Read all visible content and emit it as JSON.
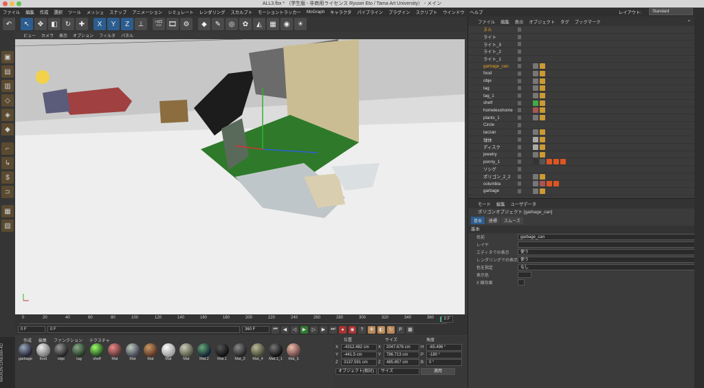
{
  "window": {
    "title": "ALL3.fbx *  （学生版 - 非商用ライセンス Ryusei Eto / Tama Art University） - メイン"
  },
  "menubar": {
    "items": [
      "ファイル",
      "編集",
      "作成",
      "選択",
      "ツール",
      "メッシュ",
      "スナップ",
      "アニメーション",
      "シミュレート",
      "レンダリング",
      "スカルプト",
      "モーショントラッカー",
      "MoGraph",
      "キャラクタ",
      "パイプライン",
      "プラグイン",
      "スクリプト",
      "ウインドウ",
      "ヘルプ"
    ],
    "layout_label": "レイアウト:",
    "layout_value": "Standard"
  },
  "viewport": {
    "menu": [
      "ビュー",
      "カメラ",
      "表示",
      "オプション",
      "フィルタ",
      "パネル"
    ]
  },
  "timeline": {
    "ticks": [
      "0",
      "20",
      "40",
      "60",
      "80",
      "100",
      "120",
      "140",
      "160",
      "180",
      "200",
      "220",
      "240",
      "260",
      "280",
      "300",
      "320",
      "340",
      "360"
    ],
    "current_frame": "0 F",
    "start_field": "0 F",
    "min_field": "0 F",
    "max_field": "360 F",
    "end_field": "360 F",
    "right_frame": "0 F"
  },
  "materials": {
    "menu": [
      "作成",
      "編集",
      "ファンクション",
      "テクスチャ"
    ],
    "items": [
      "garbage",
      "food",
      "obje",
      "tag",
      "shelf",
      "Mat",
      "Mat",
      "Mat",
      "Mat",
      "Mat",
      "Mat.2",
      "Mat.1",
      "Mat_2",
      "Mat_4",
      "Mat.1_1",
      "Mat_5"
    ]
  },
  "coordinates": {
    "headers": [
      "位置",
      "サイズ",
      "角度"
    ],
    "rows": [
      {
        "axis": "X",
        "pos": "-4312.482 cm",
        "size": "2047.676 cm",
        "rl": "H",
        "rot": "-65.496 °"
      },
      {
        "axis": "Y",
        "pos": "-441.5 cm",
        "size": "786.713 cm",
        "rl": "P",
        "rot": "-180 °"
      },
      {
        "axis": "Z",
        "pos": "3137.591 cm",
        "size": "485.857 cm",
        "rl": "B",
        "rot": "0 °"
      }
    ],
    "mode": "オブジェクト(相対)",
    "size_mode": "サイズ",
    "apply": "適用"
  },
  "objects": {
    "menu": [
      "ファイル",
      "編集",
      "表示",
      "オブジェクト",
      "タグ",
      "ブックマーク"
    ],
    "items": [
      "ヌル",
      "ライト",
      "ライト_3",
      "ライト_2",
      "ライト_1",
      "garbage_can",
      "food",
      "obje",
      "tag",
      "tag_1",
      "shelf",
      "homelesshome",
      "plants_1",
      "Circle",
      "taczan",
      "球体",
      "ディスク",
      "jewelry",
      "ponny_1",
      "ソシゲ",
      "ポリゴン_2_2",
      "columbia",
      "garbage"
    ],
    "selected": "garbage_can"
  },
  "attributes": {
    "menu": [
      "モード",
      "編集",
      "ユーザデータ"
    ],
    "title": "ポリゴンオブジェクト [garbage_can]",
    "tabs": [
      "基本",
      "座標",
      "スムーズ"
    ],
    "section": "基本",
    "rows": [
      {
        "label": "名前",
        "value": "garbage_can"
      },
      {
        "label": "レイヤ",
        "value": ""
      },
      {
        "label": "エディタでの表示",
        "value": "使う"
      },
      {
        "label": "レンダリングでの表示",
        "value": "使う"
      },
      {
        "label": "色を指定",
        "value": "なし"
      },
      {
        "label": "表示色",
        "value": ""
      },
      {
        "label": "X 線効果",
        "value": ""
      }
    ]
  },
  "brand": {
    "text": "MAXON CINEMA 4D"
  }
}
